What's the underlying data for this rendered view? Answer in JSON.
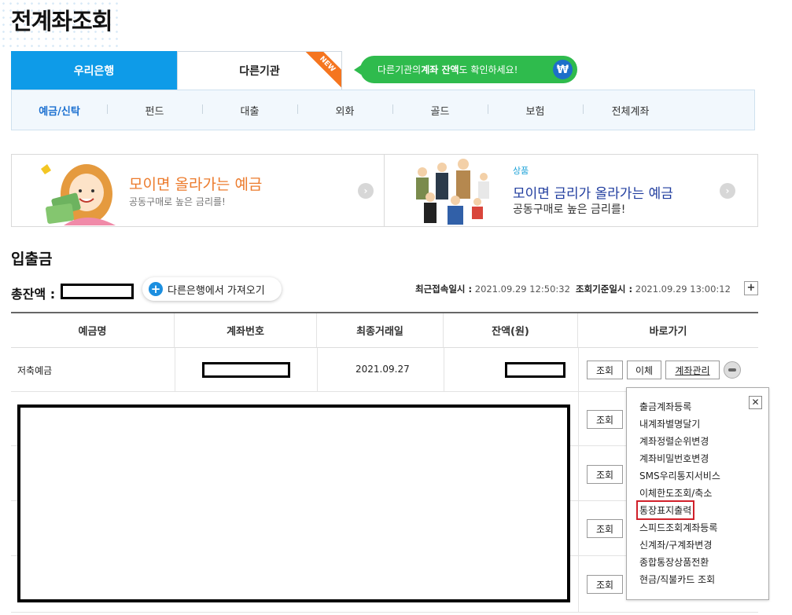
{
  "page": {
    "title": "전계좌조회"
  },
  "tabs": {
    "woori": "우리은행",
    "other": "다른기관",
    "new_badge": "NEW",
    "promo_before": "다른기관의 ",
    "promo_bold": "계좌 잔액",
    "promo_after": "도 확인하세요!",
    "promo_icon": "₩"
  },
  "subnav": [
    "예금/신탁",
    "펀드",
    "대출",
    "외화",
    "골드",
    "보험",
    "전체계좌"
  ],
  "banners": {
    "left": {
      "title": "모이면 올라가는 예금",
      "subtitle": "공동구매로 높은 금리를!"
    },
    "right": {
      "tag": "상품",
      "title": "모이면 금리가 올라가는 예금",
      "subtitle": "공동구매로 높은 금리를!"
    }
  },
  "section": {
    "title": "입출금",
    "total_label": "총잔액 :",
    "import_button": "다른은행에서 가져오기",
    "last_login_label": "최근접속일시 :",
    "last_login_value": "2021.09.29 12:50:32",
    "query_basis_label": "조회기준일시 :",
    "query_basis_value": "2021.09.29 13:00:12",
    "expand": "+"
  },
  "table": {
    "headers": [
      "예금명",
      "계좌번호",
      "최종거래일",
      "잔액(원)",
      "바로가기"
    ],
    "first_row": {
      "name": "저축예금",
      "last_date": "2021.09.27"
    },
    "buttons": {
      "inquiry": "조회",
      "transfer": "이체",
      "manage": "계좌관리"
    }
  },
  "popup": {
    "close": "✕",
    "items": [
      "출금계좌등록",
      "내계좌별명달기",
      "계좌정렬순위변경",
      "계좌비밀번호변경",
      "SMS우리통지서비스",
      "이체한도조회/축소",
      "통장표지출력",
      "스피드조회계좌등록",
      "신계좌/구계좌변경",
      "종합통장상품전환",
      "현금/직불카드 조회"
    ],
    "highlighted": "통장표지출력"
  },
  "colors": {
    "accent": "#0e9be8",
    "promo": "#2fbb4d",
    "badge": "#f5751f",
    "highlight": "#d0202a"
  }
}
